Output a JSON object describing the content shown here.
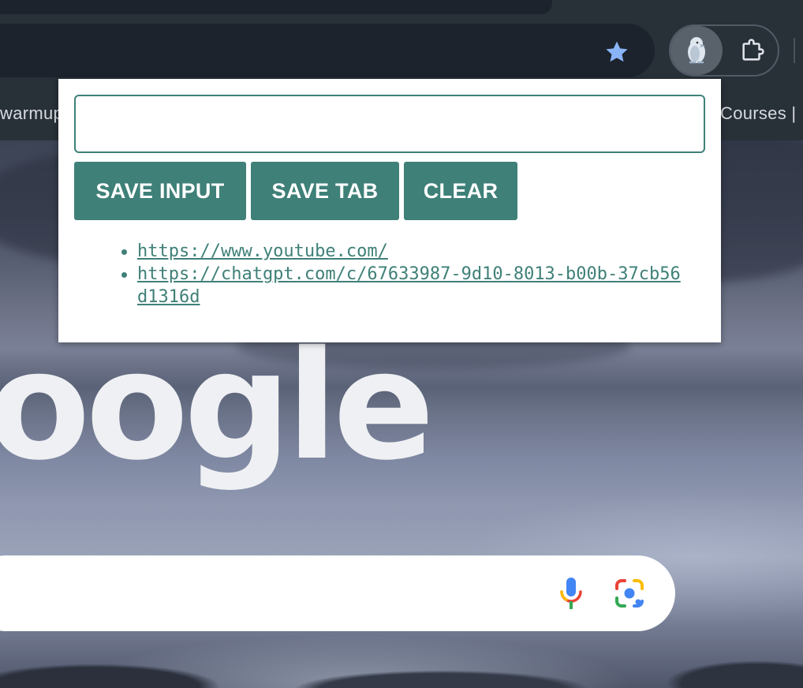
{
  "browser": {
    "bookmarks": {
      "left_label": "warmup",
      "right_label": "Courses |"
    },
    "icons": {
      "bookmark_star": "star-icon",
      "extension_active": "penguin-icon",
      "extensions_menu": "puzzle-icon"
    }
  },
  "popup": {
    "input": {
      "value": "",
      "placeholder": ""
    },
    "buttons": {
      "save_input": "SAVE INPUT",
      "save_tab": "SAVE TAB",
      "clear": "CLEAR"
    },
    "links": [
      {
        "text": "https://www.youtube.com/",
        "href": "https://www.youtube.com/"
      },
      {
        "text": "https://chatgpt.com/c/67633987-9d10-8013-b00b-37cb56d1316d",
        "href": "https://chatgpt.com/c/67633987-9d10-8013-b00b-37cb56d1316d"
      }
    ]
  },
  "newtab": {
    "logo_text": "oogle",
    "search": {
      "value": "",
      "voice_icon": "microphone-icon",
      "lens_icon": "camera-lens-icon"
    }
  },
  "colors": {
    "accent": "#3f8078",
    "star": "#8ab4f8"
  }
}
